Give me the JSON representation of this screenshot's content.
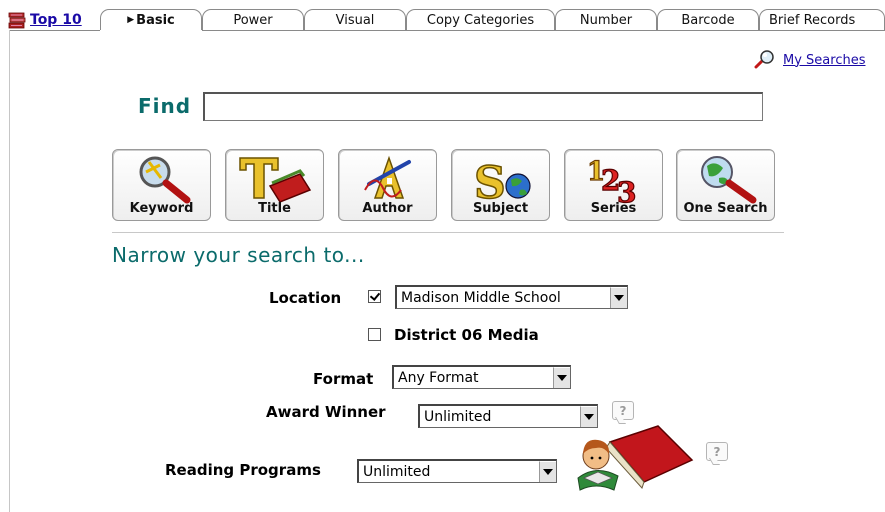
{
  "tabs": {
    "top10_label": "Top 10",
    "items": [
      {
        "label": "Basic",
        "active": true
      },
      {
        "label": "Power"
      },
      {
        "label": "Visual"
      },
      {
        "label": "Copy Categories"
      },
      {
        "label": "Number"
      },
      {
        "label": "Barcode"
      },
      {
        "label": "Brief Records"
      }
    ]
  },
  "my_searches": "My Searches",
  "find": {
    "label": "Find",
    "value": ""
  },
  "search_buttons": [
    {
      "label": "Keyword",
      "icon": "keyword-magnifier-icon"
    },
    {
      "label": "Title",
      "icon": "title-book-icon"
    },
    {
      "label": "Author",
      "icon": "author-pen-icon"
    },
    {
      "label": "Subject",
      "icon": "subject-globe-icon"
    },
    {
      "label": "Series",
      "icon": "series-123-icon"
    },
    {
      "label": "One Search",
      "icon": "one-search-globe-icon"
    }
  ],
  "narrow": {
    "heading": "Narrow your search to...",
    "location_label": "Location",
    "location_checked": true,
    "location_value": "Madison Middle School",
    "district_label": "District 06 Media",
    "district_checked": false,
    "format_label": "Format",
    "format_value": "Any Format",
    "award_label": "Award Winner",
    "award_value": "Unlimited",
    "reading_label": "Reading Programs",
    "reading_value": "Unlimited"
  },
  "colors": {
    "teal": "#0b6b6b",
    "link": "#1a0aa6"
  }
}
